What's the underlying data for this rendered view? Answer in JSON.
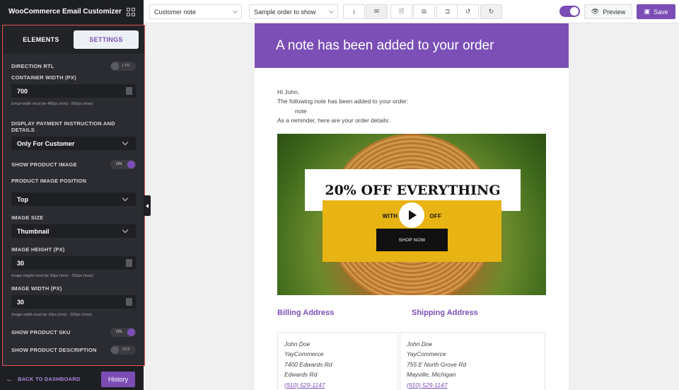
{
  "sidebar": {
    "title": "WooCommerce Email Customizer",
    "tabs": [
      {
        "label": "ELEMENTS"
      },
      {
        "label": "SETTINGS"
      }
    ],
    "settings": {
      "direction_rtl": {
        "label": "DIRECTION RTL",
        "toggle_text": "LTR"
      },
      "container_width": {
        "label": "CONTAINER WIDTH (PX)",
        "value": "700",
        "hint": "Email width must be 480px (min) - 900px (max)"
      },
      "payment_instruction": {
        "label": "DISPLAY PAYMENT INSTRUCTION AND DETAILS",
        "value": "Only For Customer"
      },
      "show_product_image": {
        "label": "SHOW PRODUCT IMAGE",
        "toggle_text": "ON"
      },
      "product_image_position": {
        "label": "PRODUCT IMAGE POSITION",
        "value": "Top"
      },
      "image_size": {
        "label": "IMAGE SIZE",
        "value": "Thumbnail"
      },
      "image_height": {
        "label": "IMAGE HEIGHT (PX)",
        "value": "30",
        "hint": "Image height must be 30px (min) - 300px (max)"
      },
      "image_width": {
        "label": "IMAGE WIDTH (PX)",
        "value": "30",
        "hint": "Image width must be 30px (min) - 300px (max)"
      },
      "show_product_sku": {
        "label": "SHOW PRODUCT SKU",
        "toggle_text": "ON"
      },
      "show_product_description": {
        "label": "SHOW PRODUCT DESCRIPTION",
        "toggle_text": "OFF"
      }
    },
    "footer": {
      "back_label": "BACK TO DASHBOARD",
      "history_label": "History"
    }
  },
  "topbar": {
    "email_type": "Customer note",
    "sample_order": "Sample order to show",
    "icons": [
      "info-icon",
      "mail-icon",
      "document-icon",
      "copy-icon",
      "import-icon",
      "undo-icon",
      "redo-icon"
    ],
    "icon_glyphs": [
      "i",
      "✉",
      "🗎",
      "⧉",
      "⊐",
      "↺",
      "↻"
    ],
    "preview_label": "Preview",
    "save_label": "Save",
    "accent_color": "#7b4db5"
  },
  "email": {
    "heading": "A note has been added to your order",
    "greeting": "Hi John,",
    "line1": "The following note has been added to your order:",
    "note": "note",
    "line2": "As a reminder, here are your order details:",
    "banner": {
      "headline": "20% OFF EVERYTHING",
      "subline_left": "WITH",
      "subline_right": "OFF",
      "button": "SHOP NOW"
    },
    "billing": {
      "title": "Billing Address",
      "lines": [
        "John Doe",
        "YayCommerce",
        "7400 Edwards Rd",
        "Edwards Rd"
      ],
      "phone": "(910) 529-1147"
    },
    "shipping": {
      "title": "Shipping Address",
      "lines": [
        "John Doe",
        "YayCommerce",
        "755 E North Grove Rd",
        "Mayville, Michigan"
      ],
      "phone": "(910) 529-1147"
    }
  }
}
